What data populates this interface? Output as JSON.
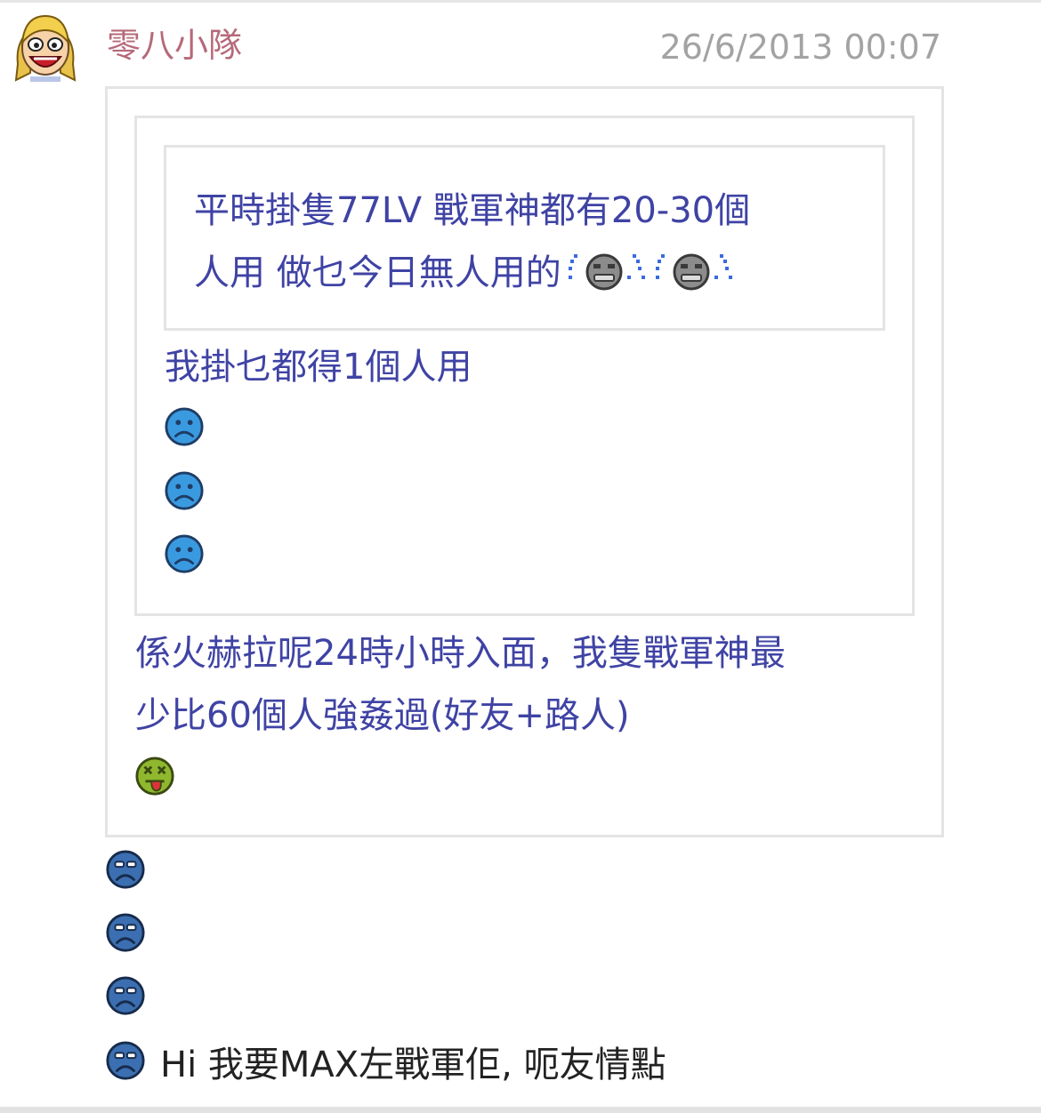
{
  "post": {
    "username": "零八小隊",
    "timestamp": "26/6/2013 00:07"
  },
  "quote_inner": {
    "line1": "平時掛隻77LV 戰軍神都有20-30個",
    "line2": "人用 做乜今日無人用的",
    "line2_emoticons": [
      "crying-face-icon",
      "crying-face-icon"
    ]
  },
  "quote_middle": {
    "text": "我掛乜都得1個人用",
    "emoticons": [
      "sad-face-icon",
      "sad-face-icon",
      "sad-face-icon"
    ]
  },
  "quote_outer": {
    "line1": "係火赫拉呢24時小時入面，我隻戰軍神最",
    "line2": "少比60個人強姦過(好友+路人)",
    "emoticon": "sick-face-icon"
  },
  "reply": {
    "emoticons": [
      "frown-face-icon",
      "frown-face-icon",
      "frown-face-icon",
      "frown-face-icon"
    ],
    "text": "Hi 我要MAX左戰軍佢, 呃友情點"
  },
  "colors": {
    "quote_text": "#3f43a4",
    "username": "#b6697a",
    "timestamp": "#a3a3a3",
    "quote_border": "#e4e4e4",
    "body_text": "#222222"
  }
}
